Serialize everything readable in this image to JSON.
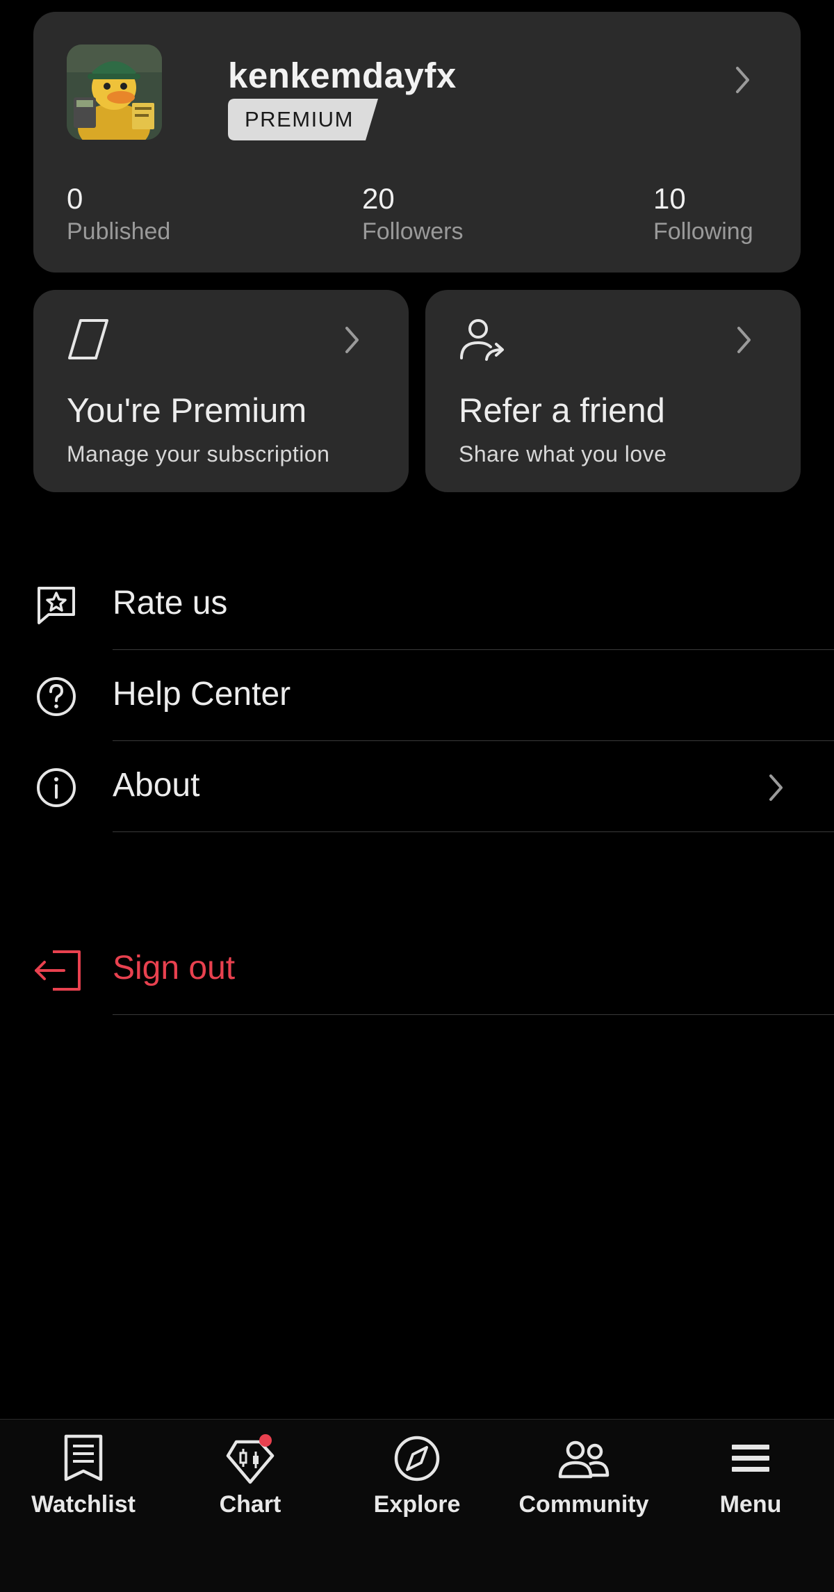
{
  "profile": {
    "username": "kenkemdayfx",
    "badge": "PREMIUM",
    "stats": [
      {
        "value": "0",
        "label": "Published"
      },
      {
        "value": "20",
        "label": "Followers"
      },
      {
        "value": "10",
        "label": "Following"
      }
    ]
  },
  "cards": {
    "premium": {
      "title": "You're Premium",
      "subtitle": "Manage your subscription"
    },
    "refer": {
      "title": "Refer a friend",
      "subtitle": "Share what you love"
    }
  },
  "menu": {
    "rate": "Rate us",
    "help": "Help Center",
    "about": "About",
    "signout": "Sign out"
  },
  "tabbar": {
    "watchlist": "Watchlist",
    "chart": "Chart",
    "explore": "Explore",
    "community": "Community",
    "menu": "Menu"
  },
  "colors": {
    "background": "#000000",
    "card": "#2b2b2b",
    "signout": "#e8414f",
    "notification_dot": "#e8414f"
  }
}
